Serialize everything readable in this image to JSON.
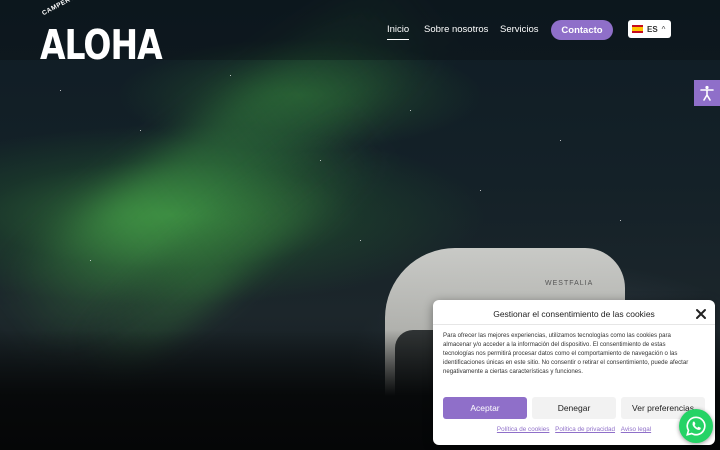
{
  "brand": {
    "logo_small": "CAMPERVAN",
    "logo_big": "ALOHA"
  },
  "nav": {
    "items": [
      {
        "label": "Inicio",
        "active": true
      },
      {
        "label": "Sobre nosotros",
        "active": false
      },
      {
        "label": "Servicios",
        "active": false
      }
    ],
    "contact_label": "Contacto",
    "language": {
      "code": "ES",
      "flag_icon": "spain-flag-icon"
    }
  },
  "hero": {
    "van_brand": "WESTFALIA"
  },
  "cookie_dialog": {
    "title": "Gestionar el consentimiento de las cookies",
    "body": "Para ofrecer las mejores experiencias, utilizamos tecnologías como las cookies para almacenar y/o acceder a la información del dispositivo. El consentimiento de estas tecnologías nos permitirá procesar datos como el comportamiento de navegación o las identificaciones únicas en este sitio. No consentir o retirar el consentimiento, puede afectar negativamente a ciertas características y funciones.",
    "accept_label": "Aceptar",
    "deny_label": "Denegar",
    "preferences_label": "Ver preferencias",
    "links": [
      "Política de cookies",
      "Política de privacidad",
      "Aviso legal"
    ]
  },
  "colors": {
    "accent": "#8f6fc9",
    "whatsapp": "#25d366"
  }
}
